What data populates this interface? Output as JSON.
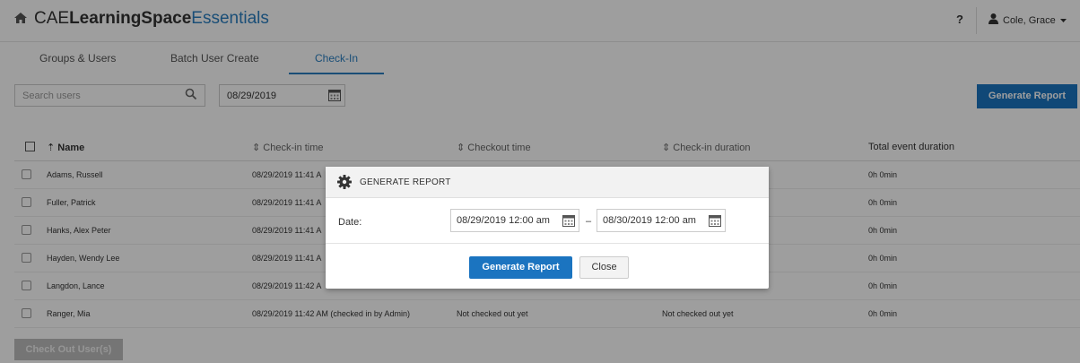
{
  "app": {
    "brand_prefix": "CAE",
    "brand_bold": "LearningSpace",
    "brand_suffix": "Essentials",
    "help": "?",
    "user_name": "Cole, Grace"
  },
  "tabs": [
    {
      "label": "Groups & Users"
    },
    {
      "label": "Batch User Create"
    },
    {
      "label": "Check-In"
    }
  ],
  "toolbar": {
    "search_placeholder": "Search users",
    "date_value": "08/29/2019",
    "generate_label": "Generate Report"
  },
  "table": {
    "headers": [
      "Name",
      "Check-in time",
      "Checkout time",
      "Check-in duration",
      "Total event duration"
    ],
    "rows": [
      {
        "name": "Adams, Russell",
        "checkin": "08/29/2019 11:41 A",
        "checkout": "",
        "duration": "",
        "total": "0h 0min"
      },
      {
        "name": "Fuller, Patrick",
        "checkin": "08/29/2019 11:41 A",
        "checkout": "",
        "duration": "",
        "total": "0h 0min"
      },
      {
        "name": "Hanks, Alex Peter",
        "checkin": "08/29/2019 11:41 A",
        "checkout": "",
        "duration": "",
        "total": "0h 0min"
      },
      {
        "name": "Hayden, Wendy Lee",
        "checkin": "08/29/2019 11:41 A",
        "checkout": "",
        "duration": "",
        "total": "0h 0min"
      },
      {
        "name": "Langdon, Lance",
        "checkin": "08/29/2019 11:42 A",
        "checkout": "",
        "duration": "",
        "total": "0h 0min"
      },
      {
        "name": "Ranger, Mia",
        "checkin": "08/29/2019 11:42 AM (checked in by Admin)",
        "checkout": "Not checked out yet",
        "duration": "Not checked out yet",
        "total": "0h 0min"
      }
    ]
  },
  "footer": {
    "checkout_label": "Check Out User(s)"
  },
  "modal": {
    "title": "GENERATE REPORT",
    "date_label": "Date:",
    "from": "08/29/2019 12:00 am",
    "separator": "–",
    "to": "08/30/2019 12:00 am",
    "generate_label": "Generate Report",
    "close_label": "Close"
  },
  "colors": {
    "accent": "#1b74c0",
    "overlay": "rgba(0,0,0,0.38)"
  },
  "icons": [
    "home-icon",
    "user-icon",
    "caret-down-icon",
    "search-icon",
    "calendar-icon",
    "gear-icon",
    "sort-icon"
  ]
}
